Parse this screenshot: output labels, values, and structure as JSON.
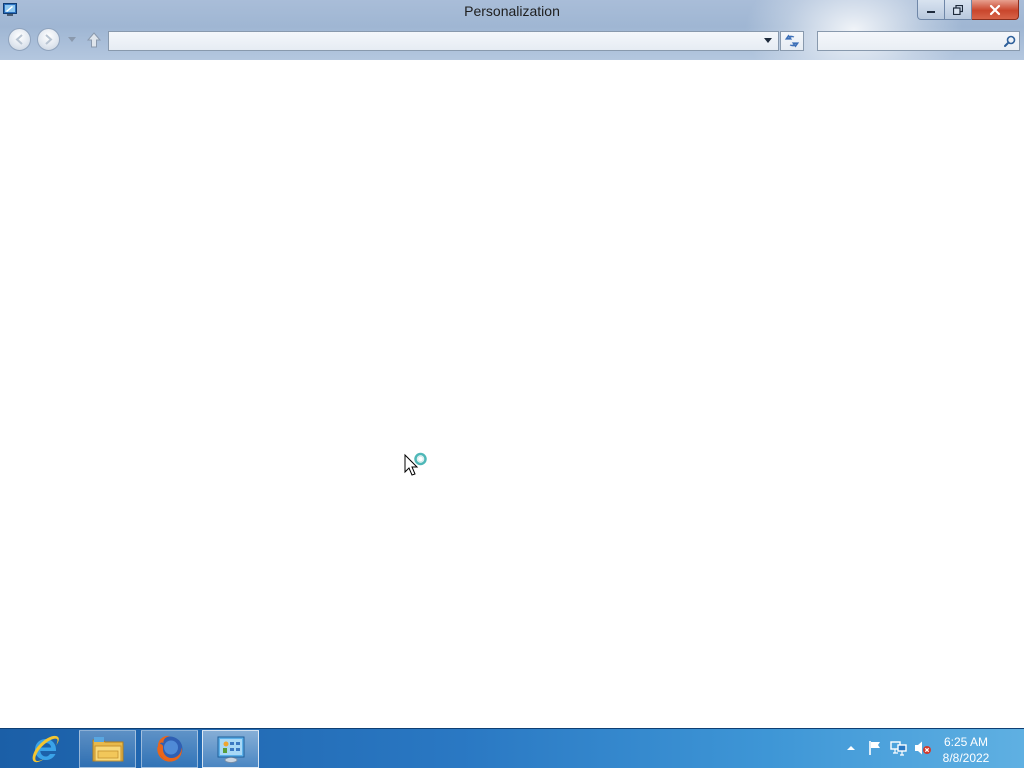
{
  "window": {
    "title": "Personalization",
    "address_value": "",
    "search_placeholder": ""
  },
  "taskbar": {
    "apps": [
      {
        "name": "Internet Explorer",
        "icon": "internet-explorer-icon"
      },
      {
        "name": "File Explorer",
        "icon": "file-explorer-icon"
      },
      {
        "name": "Firefox",
        "icon": "firefox-icon"
      },
      {
        "name": "Control Panel",
        "icon": "control-panel-icon"
      }
    ],
    "tray_icons": [
      "show-hidden-icons-icon",
      "action-center-flag-icon",
      "network-icon",
      "volume-muted-icon"
    ]
  },
  "clock": {
    "time": "6:25 AM",
    "date": "8/8/2022"
  },
  "colors": {
    "taskbar_left": "#1b5fa7",
    "taskbar_right": "#5fb0e2",
    "title_bar": "#a9bdd8",
    "close_button": "#c9462c"
  }
}
